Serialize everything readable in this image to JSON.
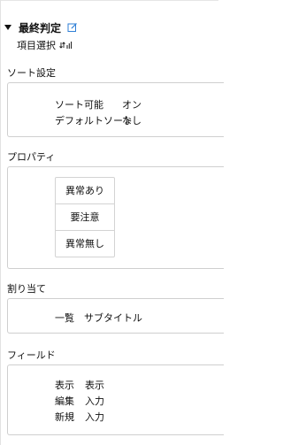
{
  "header": {
    "title": "最終判定",
    "edit_icon": "edit-icon"
  },
  "item_select": {
    "label": "項目選択",
    "sort_icon": "sort-icon"
  },
  "sort_settings": {
    "label": "ソート設定",
    "rows": [
      {
        "key": "ソート可能",
        "value": "オン"
      },
      {
        "key": "デフォルトソート",
        "value": "なし"
      }
    ]
  },
  "properties": {
    "label": "プロパティ",
    "items": [
      "異常あり",
      "要注意",
      "異常無し"
    ]
  },
  "assignment": {
    "label": "割り当て",
    "row": {
      "key": "一覧",
      "value": "サブタイトル"
    }
  },
  "fields": {
    "label": "フィールド",
    "rows": [
      {
        "key": "表示",
        "value": "表示"
      },
      {
        "key": "編集",
        "value": "入力"
      },
      {
        "key": "新規",
        "value": "入力"
      }
    ]
  },
  "colors": {
    "accent": "#2f7fd6",
    "border": "#cfcfcf"
  }
}
